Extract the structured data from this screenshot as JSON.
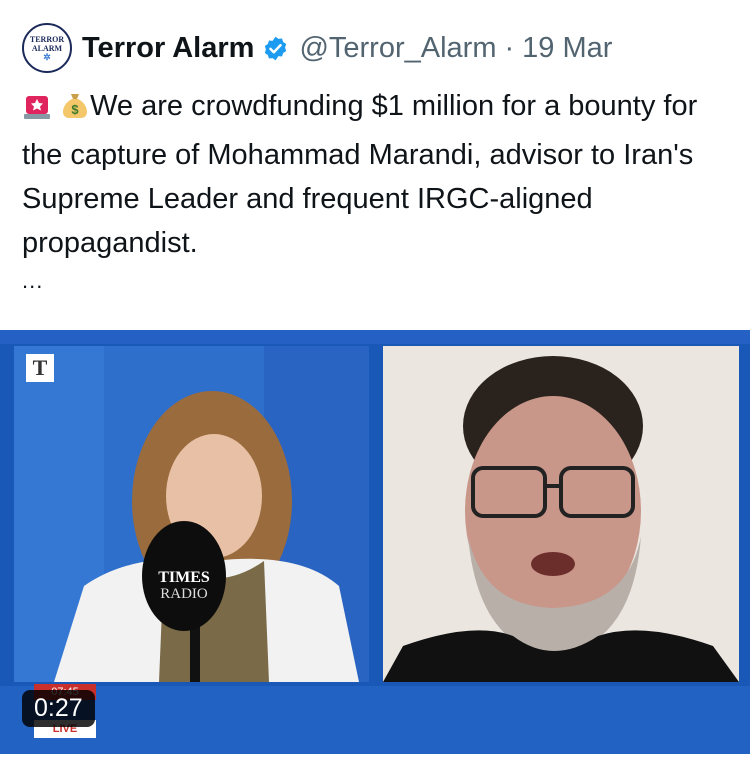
{
  "tweet": {
    "author_name": "Terror Alarm",
    "handle": "@Terror_Alarm",
    "separator": "·",
    "date": "19 Mar",
    "avatar_text_top": "TERROR",
    "avatar_text_bottom": "ALARM",
    "body": "We are crowdfunding $1 million for a bounty for the capture of Mohammad Marandi, advisor to Iran's Supreme Leader and frequent IRGC-aligned propagandist.",
    "more": "...",
    "emojis": [
      "police-light-icon",
      "money-bag-icon"
    ]
  },
  "video": {
    "duration": "0:27",
    "channel_logo": "T",
    "mic_brand_line1": "TIMES",
    "mic_brand_line2": "RADIO",
    "timestamp": "07:45",
    "live_label": "LIVE"
  },
  "colors": {
    "verified": "#1d9bf0",
    "video_bg": "#1a58b8",
    "meta_text": "#536471"
  }
}
